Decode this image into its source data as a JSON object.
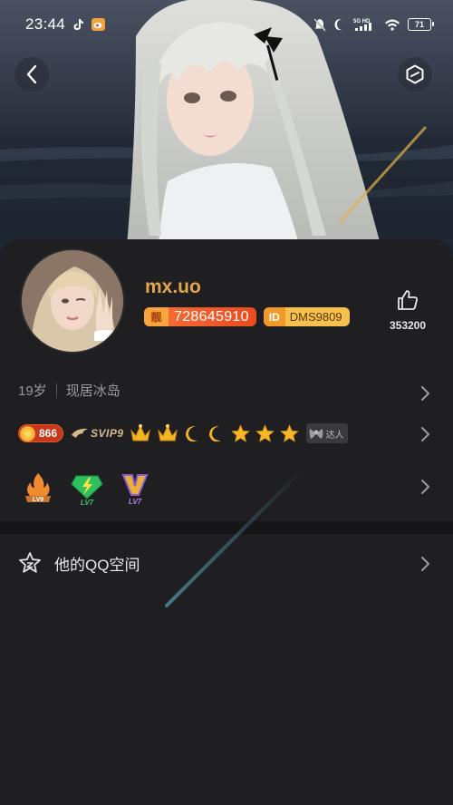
{
  "status": {
    "time": "23:44",
    "battery": "71",
    "network": "5G HD"
  },
  "profile": {
    "username": "mx.uo",
    "qq_tag": "靓",
    "qq_number": "728645910",
    "id_tag": "ID",
    "id_value": "DMS9809",
    "likes": "353200",
    "age": "19岁",
    "location": "现居冰岛"
  },
  "badges": {
    "coin_count": "866",
    "svip_label": "SVIP9",
    "daren_label": "达人"
  },
  "levels": {
    "fire_level": "LV9",
    "diamond_level": "LV7",
    "vip_level": "LV7"
  },
  "qzone": {
    "label": "他的QQ空间"
  },
  "colors": {
    "username": "#e3a74a",
    "qq_badge": "#ec4a1f",
    "id_badge": "#f6c24d",
    "background": "#1f1f22"
  }
}
